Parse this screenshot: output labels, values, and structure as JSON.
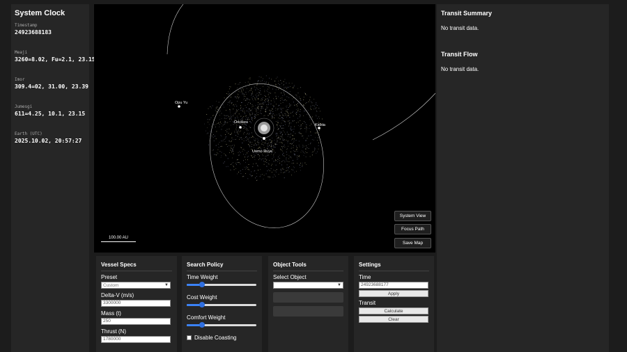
{
  "clock": {
    "title": "System Clock",
    "entries": [
      {
        "label": "Timestamp",
        "value": "24923688183"
      },
      {
        "label": "Meaji",
        "value": "3260=8.02, Fu=2.1, 23.15"
      },
      {
        "label": "Imor",
        "value": "309.4=02, 31.00, 23.39"
      },
      {
        "label": "Jumesgi",
        "value": "611=4.25, 10.1, 23.15"
      },
      {
        "label": "Earth (UTC)",
        "value": "2025.10.02, 20:57:27"
      }
    ]
  },
  "map": {
    "bodies": [
      {
        "name": "Opu Yu"
      },
      {
        "name": "Oricikes"
      },
      {
        "name": "Kidxia"
      },
      {
        "name": "Uomo Ruye"
      }
    ],
    "buttons": {
      "system_view": "System View",
      "focus_path": "Focus Path",
      "save_map": "Save Map"
    },
    "scale_label": "100.00 AU"
  },
  "summary": {
    "transit_summary_title": "Transit Summary",
    "transit_summary_text": "No transit data.",
    "transit_flow_title": "Transit Flow",
    "transit_flow_text": "No transit data."
  },
  "vessel": {
    "title": "Vessel Specs",
    "preset_label": "Preset",
    "preset_value": "Custom",
    "delta_v_label": "Delta-V (m/s)",
    "delta_v_value": "3300000",
    "mass_label": "Mass (t)",
    "mass_value": "250",
    "thrust_label": "Thrust (N)",
    "thrust_value": "1780000"
  },
  "search": {
    "title": "Search Policy",
    "time_weight_label": "Time Weight",
    "time_weight": 0.22,
    "cost_weight_label": "Cost Weight",
    "cost_weight": 0.22,
    "comfort_weight_label": "Comfort Weight",
    "comfort_weight": 0.22,
    "disable_coasting_label": "Disable Coasting",
    "disable_coasting": false
  },
  "objects": {
    "title": "Object Tools",
    "select_label": "Select Object",
    "select_value": ""
  },
  "settings": {
    "title": "Settings",
    "time_label": "Time",
    "time_value": "24923688177",
    "apply_label": "Apply",
    "transit_label": "Transit",
    "calculate_label": "Calculate",
    "clear_label": "Clear"
  },
  "colors": {
    "accent": "#3b82f6",
    "panel": "#262626",
    "background": "#1c1c1c"
  }
}
